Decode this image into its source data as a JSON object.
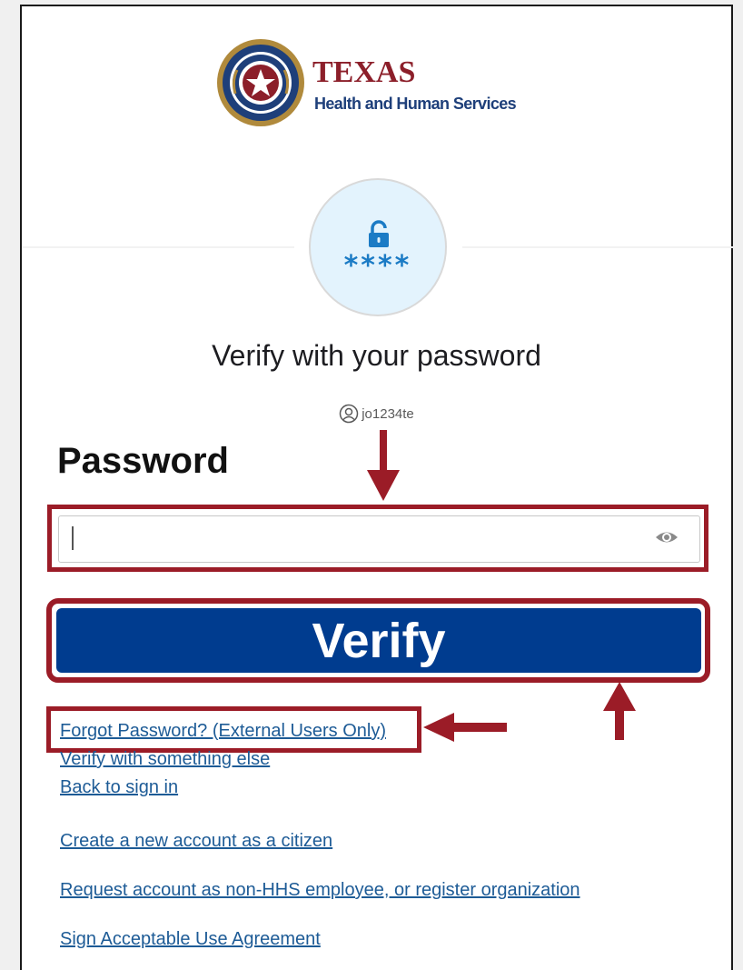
{
  "brand": {
    "title": "TEXAS",
    "subtitle": "Health and Human Services",
    "logo_icon": "texas-hhs-seal-icon",
    "colors": {
      "maroon": "#8c1f2a",
      "navy": "#1e3f7a",
      "gold": "#b08a3c"
    }
  },
  "auth": {
    "badge_icon": "password-lock-icon",
    "badge_stars": "****",
    "heading": "Verify with your password",
    "username": "jo1234te",
    "user_icon": "user-circle-icon"
  },
  "form": {
    "password_label": "Password",
    "password_value": "",
    "eye_icon": "eye-icon",
    "verify_label": "Verify"
  },
  "links": {
    "forgot_password": "Forgot Password? (External Users Only)",
    "verify_else": "Verify with something else",
    "back_to_sign_in": "Back to sign in",
    "create_account": "Create a new account as a citizen",
    "request_account": "Request account as non-HHS employee, or register organization",
    "acceptable_use": "Sign Acceptable Use Agreement"
  },
  "annotations": {
    "highlight_color": "#9b1c27",
    "button_color": "#003c8f",
    "link_color": "#1d5b96",
    "badge_bg": "#e3f3fd"
  }
}
